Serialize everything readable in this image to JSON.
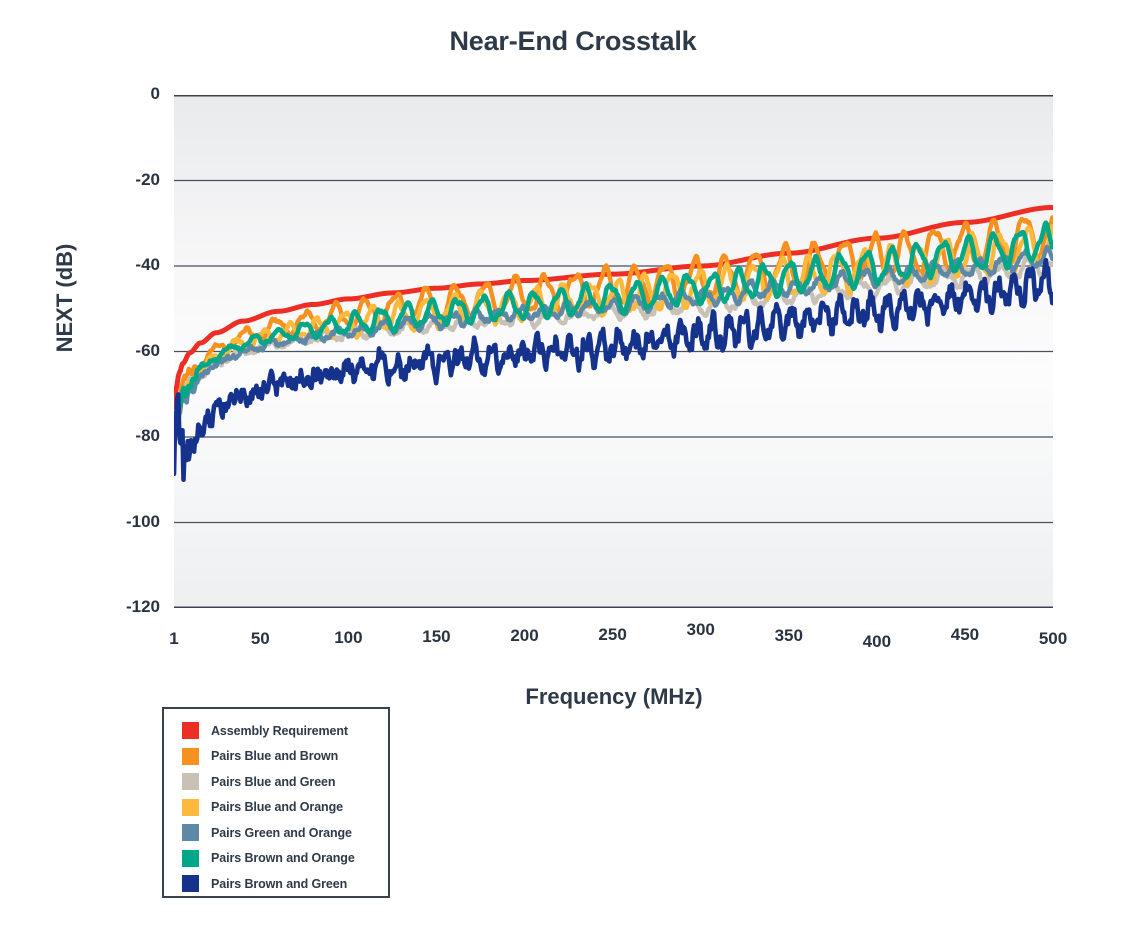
{
  "chart_data": {
    "type": "line",
    "title": "Near-End Crosstalk",
    "xlabel": "Frequency (MHz)",
    "ylabel": "NEXT (dB)",
    "xlim": [
      1,
      500
    ],
    "ylim": [
      -120,
      0
    ],
    "xticks": [
      1,
      50,
      100,
      150,
      200,
      250,
      300,
      350,
      400,
      450,
      500
    ],
    "yticks": [
      0,
      -20,
      -40,
      -60,
      -80,
      -100,
      -120
    ],
    "xtick_labels": [
      "1",
      "50",
      "100",
      "150",
      "200",
      "250",
      "300",
      "350",
      "400",
      "450",
      "500"
    ],
    "ytick_labels": [
      "0",
      "-20",
      "-40",
      "-60",
      "-80",
      "-100",
      "-120"
    ],
    "grid": "horizontal",
    "legend_position": "below-left",
    "plot_bg_top": "#eaebed",
    "plot_bg_mid": "#fbfbfc",
    "plot_bg_bottom": "#f1f2f3",
    "gridline_color": "#4a505c",
    "axis_color": "#3a4250",
    "series": [
      {
        "name": "Assembly Requirement",
        "color": "#ed2e24",
        "width": 5.0,
        "ripple_amp": 0,
        "ripple_period": 0,
        "noise": 0,
        "x": [
          1,
          2,
          4,
          6,
          10,
          16,
          25,
          40,
          60,
          80,
          100,
          125,
          150,
          175,
          200,
          250,
          300,
          350,
          400,
          450,
          500
        ],
        "y": [
          -73.0,
          -69.0,
          -65.0,
          -62.8,
          -60.3,
          -58.0,
          -55.6,
          -52.9,
          -50.6,
          -49.0,
          -47.7,
          -46.3,
          -45.2,
          -44.2,
          -43.4,
          -41.9,
          -40.0,
          -37.0,
          -33.5,
          -29.8,
          -26.3
        ]
      },
      {
        "name": "Pairs Blue and Brown",
        "color": "#f6901e",
        "width": 4.4,
        "ripple_amp": 4.8,
        "ripple_period": 17.0,
        "noise": 0.6,
        "x": [
          1,
          2,
          4,
          6,
          10,
          16,
          25,
          40,
          60,
          80,
          100,
          125,
          150,
          175,
          200,
          250,
          300,
          350,
          400,
          450,
          500
        ],
        "y": [
          -80.0,
          -75.5,
          -71.0,
          -68.5,
          -65.5,
          -62.5,
          -59.5,
          -56.5,
          -54.2,
          -52.8,
          -51.5,
          -50.0,
          -48.8,
          -47.8,
          -46.8,
          -45.0,
          -43.0,
          -40.5,
          -38.0,
          -35.4,
          -32.6
        ]
      },
      {
        "name": "Pairs Blue and Green",
        "color": "#c9c1b5",
        "width": 4.4,
        "ripple_amp": 1.8,
        "ripple_period": 16.0,
        "noise": 1.1,
        "x": [
          1,
          2,
          4,
          6,
          10,
          16,
          25,
          40,
          60,
          80,
          100,
          125,
          150,
          175,
          200,
          250,
          300,
          350,
          400,
          450,
          500
        ],
        "y": [
          -82.0,
          -78.0,
          -74.0,
          -71.5,
          -68.5,
          -65.5,
          -62.5,
          -59.8,
          -58.0,
          -56.8,
          -55.8,
          -54.6,
          -53.6,
          -52.8,
          -52.0,
          -50.6,
          -49.0,
          -46.8,
          -44.6,
          -42.4,
          -40.2
        ]
      },
      {
        "name": "Pairs Blue and Orange",
        "color": "#fdb93c",
        "width": 4.4,
        "ripple_amp": 4.3,
        "ripple_period": 15.5,
        "noise": 0.7,
        "x": [
          1,
          2,
          4,
          6,
          10,
          16,
          25,
          40,
          60,
          80,
          100,
          125,
          150,
          175,
          200,
          250,
          300,
          350,
          400,
          450,
          500
        ],
        "y": [
          -84.0,
          -79.0,
          -74.0,
          -71.0,
          -67.5,
          -64.5,
          -61.0,
          -58.0,
          -56.0,
          -54.6,
          -53.4,
          -52.0,
          -50.8,
          -49.8,
          -49.0,
          -47.2,
          -45.2,
          -42.8,
          -40.4,
          -37.8,
          -35.0
        ]
      },
      {
        "name": "Pairs Green and Orange",
        "color": "#5e89a6",
        "width": 4.4,
        "ripple_amp": 1.7,
        "ripple_period": 13.0,
        "noise": 1.0,
        "x": [
          1,
          2,
          4,
          6,
          10,
          16,
          25,
          40,
          60,
          80,
          100,
          125,
          150,
          175,
          200,
          250,
          300,
          350,
          400,
          450,
          500
        ],
        "y": [
          -83.0,
          -78.5,
          -74.5,
          -72.0,
          -69.0,
          -66.0,
          -63.0,
          -60.0,
          -58.0,
          -56.6,
          -55.4,
          -54.0,
          -52.8,
          -51.8,
          -51.0,
          -49.2,
          -47.2,
          -45.0,
          -42.6,
          -40.4,
          -38.2
        ]
      },
      {
        "name": "Pairs Brown and Orange",
        "color": "#00a887",
        "width": 4.6,
        "ripple_amp": 3.6,
        "ripple_period": 14.5,
        "noise": 0.6,
        "x": [
          1,
          2,
          4,
          6,
          10,
          16,
          25,
          40,
          60,
          80,
          100,
          125,
          150,
          175,
          200,
          250,
          300,
          350,
          400,
          450,
          500
        ],
        "y": [
          -81.0,
          -77.0,
          -72.5,
          -70.0,
          -67.0,
          -64.0,
          -61.0,
          -58.2,
          -56.2,
          -54.8,
          -53.6,
          -52.2,
          -51.0,
          -50.0,
          -49.2,
          -47.4,
          -45.4,
          -42.8,
          -40.2,
          -37.4,
          -34.4
        ]
      },
      {
        "name": "Pairs Brown and Green",
        "color": "#15338d",
        "width": 4.6,
        "ripple_amp": 3.0,
        "ripple_period": 9.0,
        "noise": 3.6,
        "x": [
          1,
          2,
          4,
          6,
          10,
          16,
          25,
          40,
          60,
          80,
          100,
          125,
          150,
          175,
          200,
          250,
          300,
          350,
          400,
          450,
          500
        ],
        "y": [
          -82.0,
          -84.0,
          -86.0,
          -85.0,
          -82.0,
          -78.0,
          -74.0,
          -70.0,
          -67.5,
          -65.8,
          -64.5,
          -63.2,
          -62.2,
          -61.4,
          -60.8,
          -58.8,
          -56.2,
          -53.2,
          -50.2,
          -47.2,
          -44.2
        ]
      }
    ]
  },
  "legend": {
    "items": [
      {
        "label": "Assembly Requirement",
        "color": "#ed2e24"
      },
      {
        "label": "Pairs Blue and Brown",
        "color": "#f6901e"
      },
      {
        "label": "Pairs Blue and Green",
        "color": "#c9c1b5"
      },
      {
        "label": "Pairs Blue and Orange",
        "color": "#fdb93c"
      },
      {
        "label": "Pairs Green and Orange",
        "color": "#5e89a6"
      },
      {
        "label": "Pairs Brown and Orange",
        "color": "#00a887"
      },
      {
        "label": "Pairs Brown and Green",
        "color": "#15338d"
      }
    ]
  }
}
